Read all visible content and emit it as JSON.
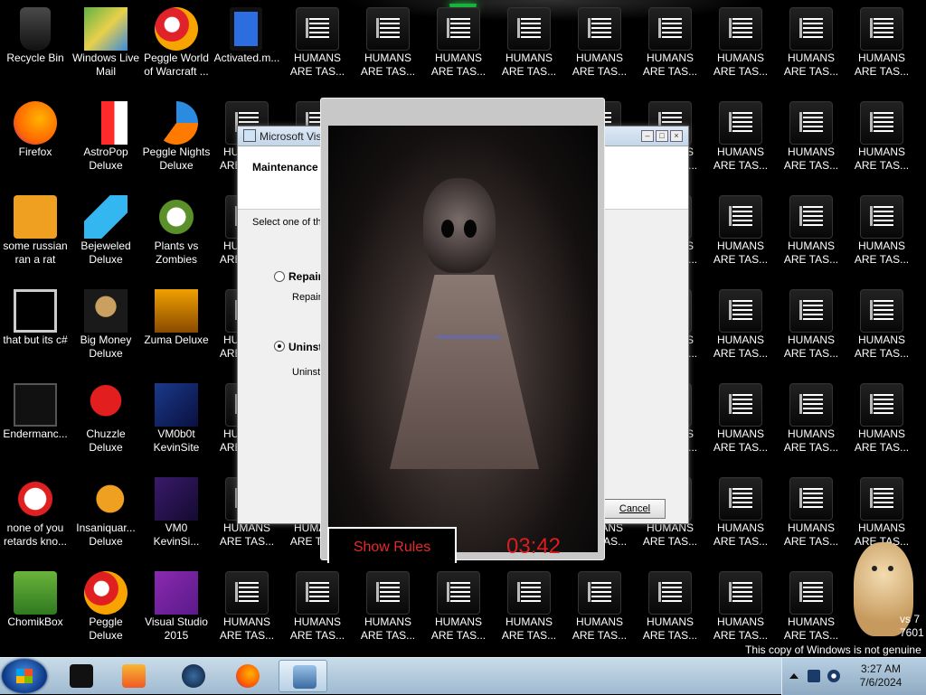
{
  "desktop": {
    "icons": [
      {
        "label": "Recycle Bin",
        "icon": "recycle-bin-icon"
      },
      {
        "label": "Windows Live Mail",
        "icon": "windows-live-mail-icon"
      },
      {
        "label": "Peggle World of Warcraft ...",
        "icon": "peggle-wow-icon"
      },
      {
        "label": "Activated.m...",
        "icon": "activated-file-icon"
      },
      {
        "label": "Firefox",
        "icon": "firefox-icon"
      },
      {
        "label": "AstroPop Deluxe",
        "icon": "astropop-icon"
      },
      {
        "label": "Peggle Nights Deluxe",
        "icon": "peggle-nights-icon"
      },
      {
        "label": "some russian ran a rat",
        "icon": "rat-file-icon"
      },
      {
        "label": "Bejeweled Deluxe",
        "icon": "bejeweled-icon"
      },
      {
        "label": "Plants vs Zombies",
        "icon": "plants-vs-zombies-icon"
      },
      {
        "label": "that but its c#",
        "icon": "shortcut-icon"
      },
      {
        "label": "Big Money Deluxe",
        "icon": "big-money-icon"
      },
      {
        "label": "Zuma Deluxe",
        "icon": "zuma-icon"
      },
      {
        "label": "Endermanc...",
        "icon": "endermanch-icon"
      },
      {
        "label": "Chuzzle Deluxe",
        "icon": "chuzzle-icon"
      },
      {
        "label": "VM0b0t KevinSite",
        "icon": "vm0b0t-icon"
      },
      {
        "label": "none of you retards kno...",
        "icon": "file-icon"
      },
      {
        "label": "Insaniquar... Deluxe",
        "icon": "insaniquarium-icon"
      },
      {
        "label": "VM0 KevinSi...",
        "icon": "vm0-icon"
      },
      {
        "label": "ChomikBox",
        "icon": "chomikbox-icon"
      },
      {
        "label": "Peggle Deluxe",
        "icon": "peggle-icon"
      },
      {
        "label": "Visual Studio 2015",
        "icon": "visual-studio-icon"
      }
    ],
    "humans_label": "HUMANS ARE TAS...",
    "humans_icon": "humans-file-icon"
  },
  "installer": {
    "title": "Microsoft Vis",
    "header": "Maintenance",
    "instruction": "Select one of th",
    "options": [
      {
        "label": "Repair",
        "desc": "Repair",
        "selected": false
      },
      {
        "label": "Uninst",
        "desc": "Uninst",
        "selected": true
      }
    ],
    "cancel": "Cancel"
  },
  "scare_window": {
    "show_rules": "Show Rules",
    "timer": "03:42"
  },
  "watermark": {
    "not_genuine": "This copy of Windows is not genuine",
    "version": "vs 7 7601"
  },
  "taskbar": {
    "buttons": [
      "terminal",
      "media-player",
      "steam",
      "firefox",
      "installer"
    ],
    "time": "3:27 AM",
    "date": "7/6/2024"
  },
  "colors": {
    "accent": "#d81e1e",
    "taskbar": "#b8cfe2"
  }
}
